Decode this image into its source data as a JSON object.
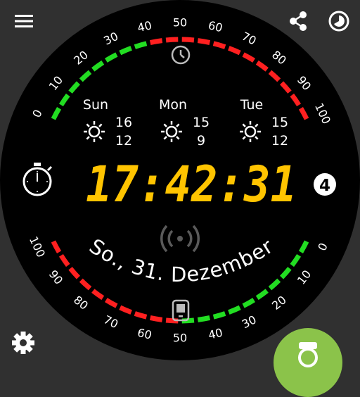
{
  "app": {
    "menu_icon": "menu-icon",
    "share_icon": "share-icon",
    "theme_icon": "watchface-icon",
    "settings_icon": "gear-icon",
    "fab_icon": "watch-icon",
    "fab_color": "#8bc34a"
  },
  "watchface": {
    "time": "17:42:31",
    "date": "So., 31. Dezember",
    "badge_count": "4",
    "top_gauge": {
      "icon": "clock-icon",
      "labels": [
        "0",
        "10",
        "20",
        "30",
        "40",
        "50",
        "60",
        "70",
        "80",
        "90",
        "100"
      ],
      "green_until": 40,
      "colors": {
        "green": "#22dd22",
        "red": "#ff2020",
        "tick": "#ffffff"
      }
    },
    "bottom_gauge": {
      "icon": "phone-battery-icon",
      "labels": [
        "0",
        "10",
        "20",
        "30",
        "40",
        "50",
        "60",
        "70",
        "80",
        "90",
        "100"
      ],
      "green_until": 50,
      "colors": {
        "green": "#22dd22",
        "red": "#ff2020",
        "tick": "#ffffff"
      }
    },
    "weather": [
      {
        "day": "Sun",
        "high": "16",
        "low": "12",
        "icon": "sun-icon"
      },
      {
        "day": "Mon",
        "high": "15",
        "low": "9",
        "icon": "sun-icon"
      },
      {
        "day": "Tue",
        "high": "15",
        "low": "12",
        "icon": "sun-icon"
      }
    ],
    "stopwatch_icon": "stopwatch-icon",
    "signal_icon": "signal-icon",
    "time_color": "#ffc400"
  }
}
